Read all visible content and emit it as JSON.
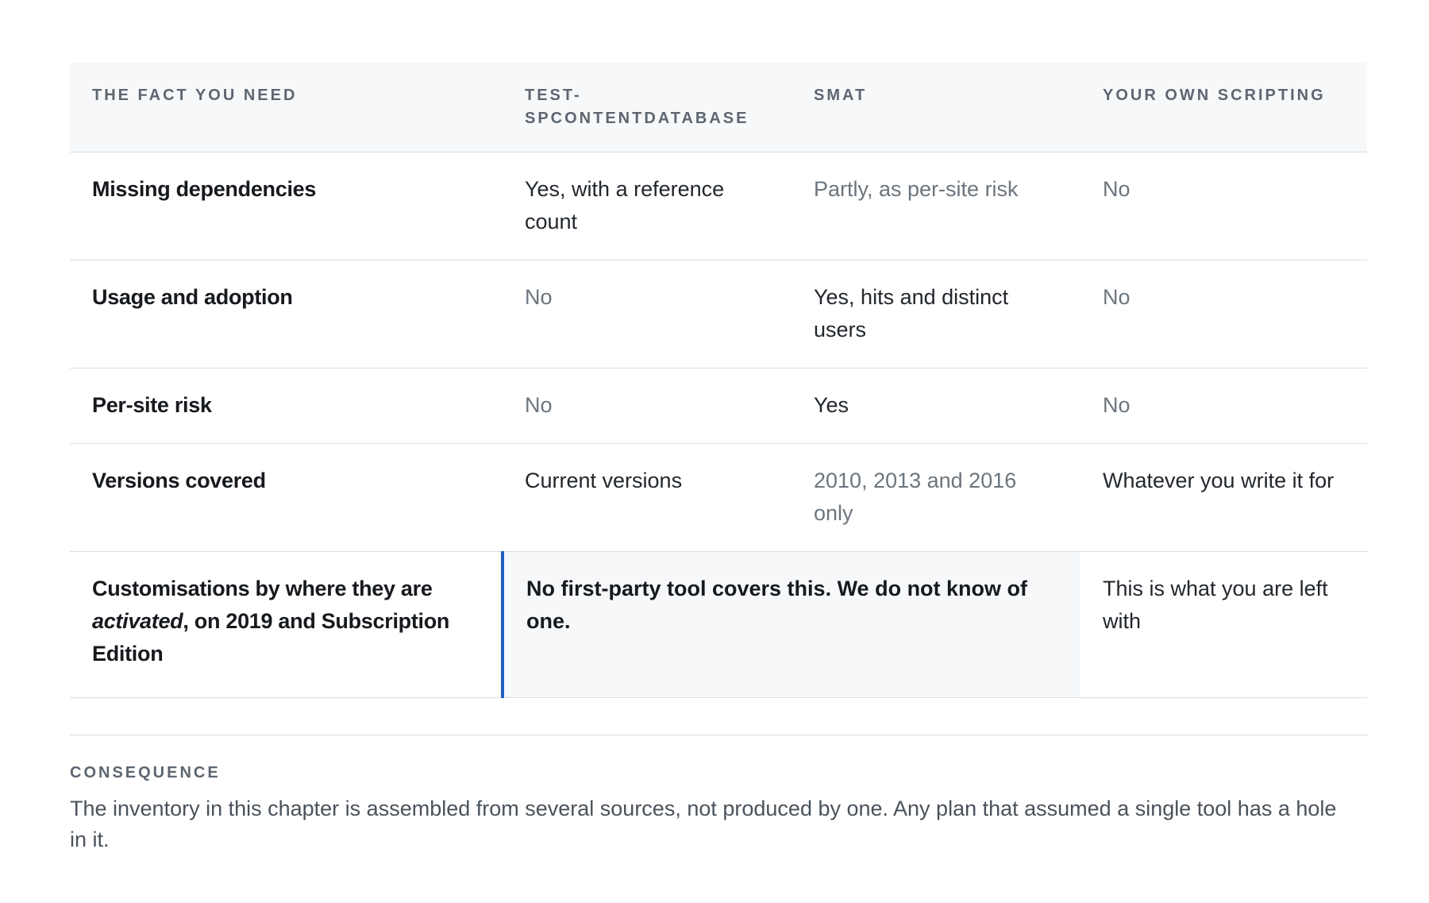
{
  "table": {
    "headers": [
      "THE FACT YOU NEED",
      "TEST-SPCONTENTDATABASE",
      "SMAT",
      "YOUR OWN SCRIPTING"
    ],
    "rows": [
      {
        "fact": "Missing dependencies",
        "test": "Yes, with a reference count",
        "smat": "Partly, as per-site risk",
        "own": "No"
      },
      {
        "fact": "Usage and adoption",
        "test": "No",
        "smat": "Yes, hits and distinct users",
        "own": "No"
      },
      {
        "fact": "Per-site risk",
        "test": "No",
        "smat": "Yes",
        "own": "No"
      },
      {
        "fact": "Versions covered",
        "test": "Current versions",
        "smat": "2010, 2013 and 2016 only",
        "own": "Whatever you write it for"
      }
    ],
    "last_row": {
      "fact_part1": "Customisations by where they are ",
      "fact_emphasis": "activated",
      "fact_part2": ", on 2019 and Subscription Edition",
      "merged": "No first-party tool covers this. We do not know of one.",
      "own": "This is what you are left with"
    }
  },
  "consequence": {
    "label": "CONSEQUENCE",
    "text": "The inventory in this chapter is assembled from several sources, not produced by one. Any plan that assumed a single tool has a hole in it."
  },
  "colors": {
    "accent": "#1f5fbf",
    "header_bg": "#f6f8fa",
    "border": "#d9dde2",
    "muted_text": "#6c757d"
  }
}
